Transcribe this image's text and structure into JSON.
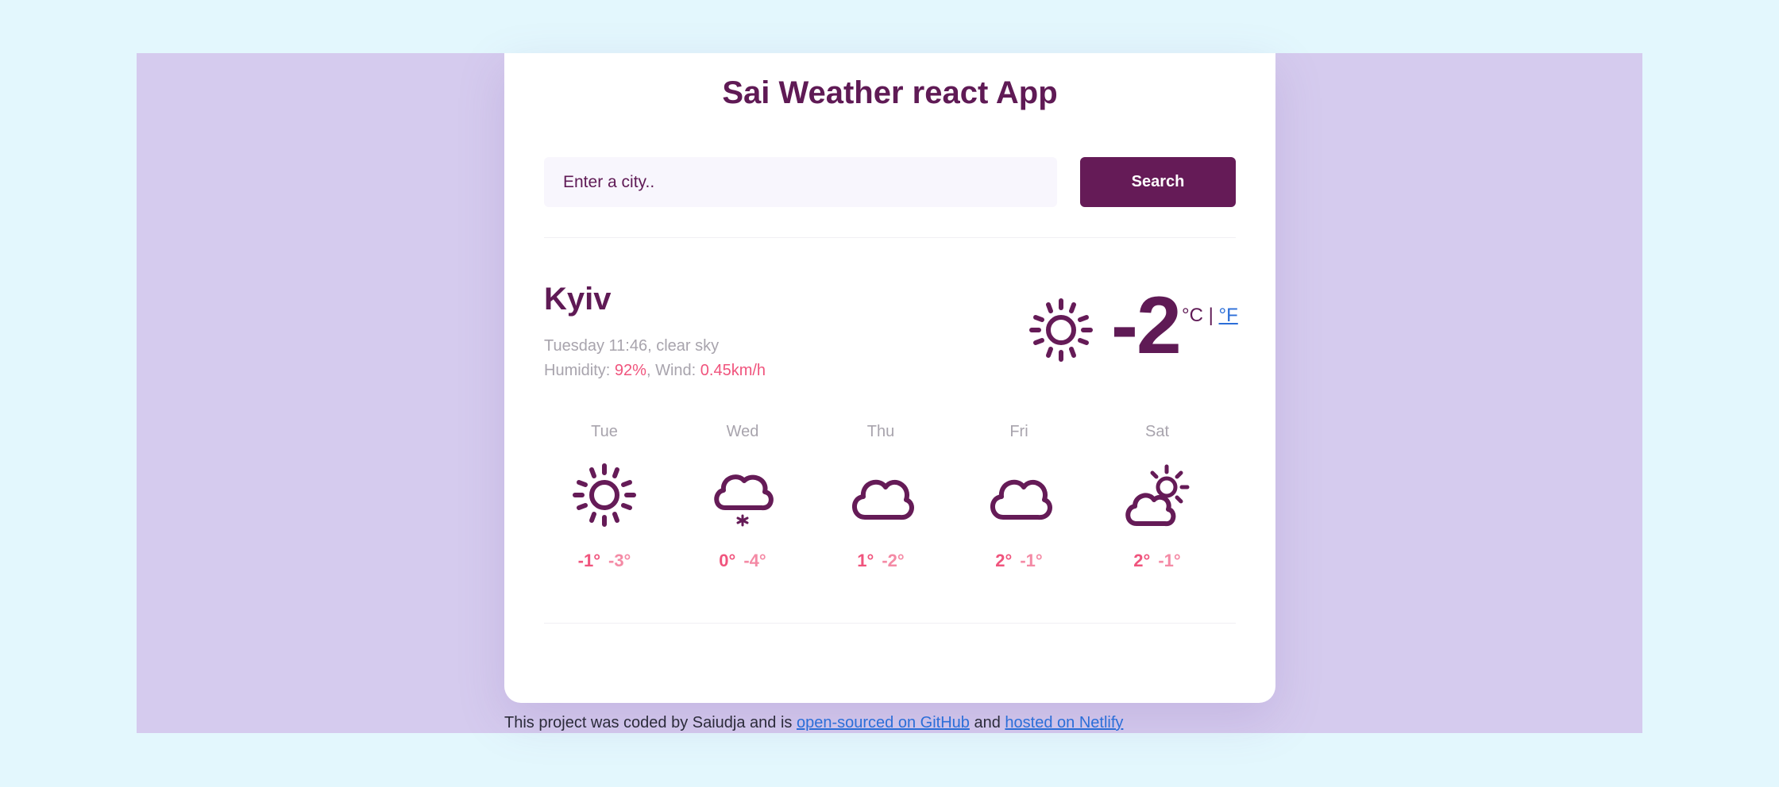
{
  "header": {
    "title": "Sai Weather react App"
  },
  "search": {
    "placeholder": "Enter a city..",
    "button_label": "Search"
  },
  "current": {
    "city": "Kyiv",
    "datetime": "Tuesday 11:46",
    "description": "clear sky",
    "humidity_label": "Humidity:",
    "humidity_value": "92%",
    "wind_label": "Wind:",
    "wind_value": "0.45km/h",
    "temperature": "-2",
    "unit_celsius": "°C",
    "unit_separator": "|",
    "unit_fahrenheit": "°F",
    "icon": "sun-icon"
  },
  "forecast": [
    {
      "day": "Tue",
      "max": "-1°",
      "min": "-3°",
      "icon": "sun-icon"
    },
    {
      "day": "Wed",
      "max": "0°",
      "min": "-4°",
      "icon": "snow-cloud-icon"
    },
    {
      "day": "Thu",
      "max": "1°",
      "min": "-2°",
      "icon": "cloud-icon"
    },
    {
      "day": "Fri",
      "max": "2°",
      "min": "-1°",
      "icon": "cloud-icon"
    },
    {
      "day": "Sat",
      "max": "2°",
      "min": "-1°",
      "icon": "partly-cloudy-icon"
    }
  ],
  "footer": {
    "text_before": "This project was coded by Saiudja and is",
    "github_link": "open-sourced on GitHub",
    "text_middle": "and",
    "netlify_link": "hosted on Netlify"
  },
  "colors": {
    "page_background": "#e3f7fd",
    "stage_background": "#d5cbee",
    "primary": "#651b57",
    "accent": "#f0547d",
    "link": "#2b6ed8"
  }
}
